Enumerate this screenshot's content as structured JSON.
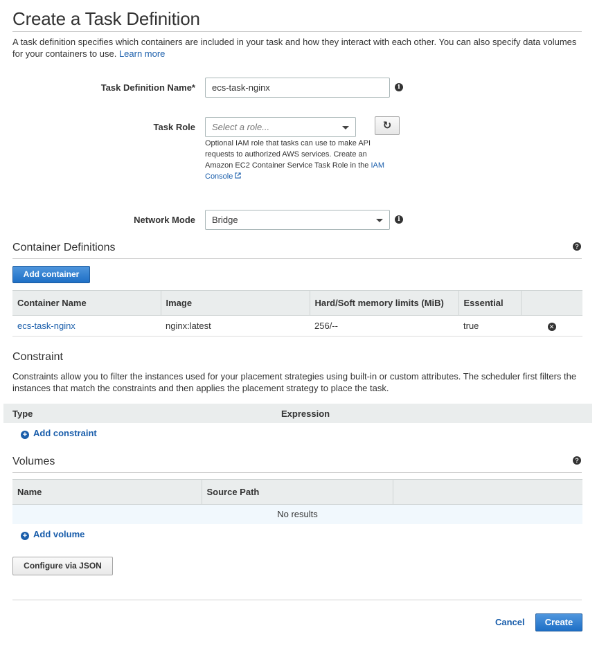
{
  "page": {
    "title": "Create a Task Definition",
    "intro_text": "A task definition specifies which containers are included in your task and how they interact with each other. You can also specify data volumes for your containers to use.",
    "learn_more": "Learn more"
  },
  "form": {
    "task_definition_name_label": "Task Definition Name*",
    "task_definition_name_value": "ecs-task-nginx",
    "task_role_label": "Task Role",
    "task_role_placeholder": "Select a role...",
    "task_role_help": "Optional IAM role that tasks can use to make API requests to authorized AWS services. Create an Amazon EC2 Container Service Task Role in the",
    "iam_console_link": "IAM Console",
    "network_mode_label": "Network Mode",
    "network_mode_value": "Bridge"
  },
  "container_definitions": {
    "title": "Container Definitions",
    "add_button": "Add container",
    "columns": [
      "Container Name",
      "Image",
      "Hard/Soft memory limits (MiB)",
      "Essential",
      ""
    ],
    "rows": [
      {
        "name": "ecs-task-nginx",
        "image": "nginx:latest",
        "memory": "256/--",
        "essential": "true"
      }
    ]
  },
  "constraint": {
    "title": "Constraint",
    "description": "Constraints allow you to filter the instances used for your placement strategies using built-in or custom attributes. The scheduler first filters the instances that match the constraints and then applies the placement strategy to place the task.",
    "columns": [
      "Type",
      "Expression"
    ],
    "add_link": "Add constraint"
  },
  "volumes": {
    "title": "Volumes",
    "columns": [
      "Name",
      "Source Path",
      ""
    ],
    "empty_text": "No results",
    "add_link": "Add volume"
  },
  "footer": {
    "configure_json": "Configure via JSON",
    "cancel": "Cancel",
    "create": "Create"
  },
  "icons": {
    "info": "info-icon",
    "help": "question-icon",
    "refresh": "refresh-icon",
    "remove": "remove-circle-icon",
    "add": "plus-circle-icon",
    "external": "external-link-icon"
  },
  "colors": {
    "accent": "#1a5eab",
    "primary_button": "#1e6fc6",
    "table_header": "#eaeded",
    "empty_row": "#f1f8fd"
  }
}
